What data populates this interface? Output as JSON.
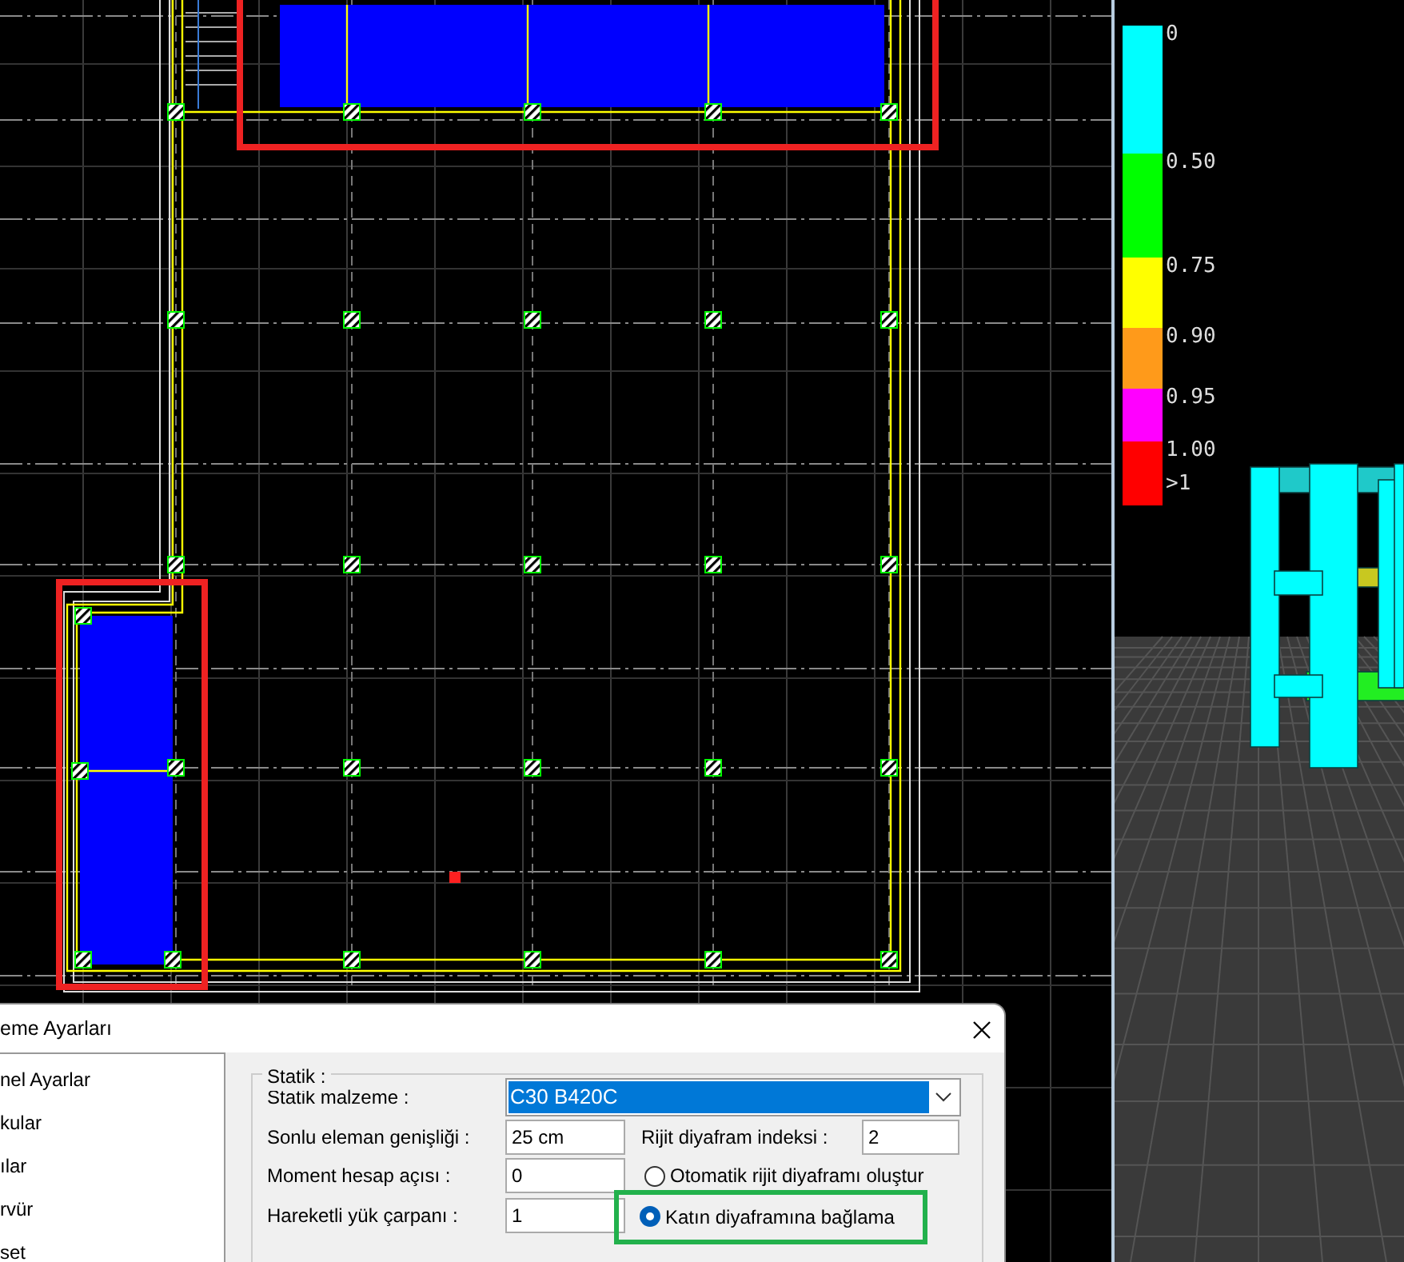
{
  "legend": [
    {
      "label": "0",
      "color": "#00ffff"
    },
    {
      "label": "0.50",
      "color": "#00ff00"
    },
    {
      "label": "0.75",
      "color": "#ffff00"
    },
    {
      "label": "0.90",
      "color": "#ff9a1a"
    },
    {
      "label": "0.95",
      "color": "#ff00ff"
    },
    {
      "label": "1.00",
      "color": "#ff0000"
    },
    {
      "label": ">1",
      "color": "#ff0000"
    }
  ],
  "dialog": {
    "title": "eme Ayarları",
    "nav_items": [
      {
        "label": "nel Ayarlar"
      },
      {
        "label": "kular"
      },
      {
        "label": "ılar"
      },
      {
        "label": "rvür"
      },
      {
        "label": "set"
      }
    ],
    "group_title": "Statik :",
    "material": {
      "label": "Statik malzeme :",
      "value": "C30 B420C"
    },
    "fields": [
      {
        "label": "Sonlu eleman genişliği :",
        "value": "25 cm"
      },
      {
        "label": "Moment hesap açısı :",
        "value": "0"
      },
      {
        "label": "Hareketli yük çarpanı :",
        "value": "1"
      }
    ],
    "rigid_index": {
      "label": "Rijit diyafram indeksi :",
      "value": "2"
    },
    "radios": [
      {
        "label": "Otomatik rijit diyaframı oluştur",
        "selected": false,
        "highlighted": false
      },
      {
        "label": "Katın diyaframına bağlama",
        "selected": true,
        "highlighted": true
      }
    ]
  }
}
